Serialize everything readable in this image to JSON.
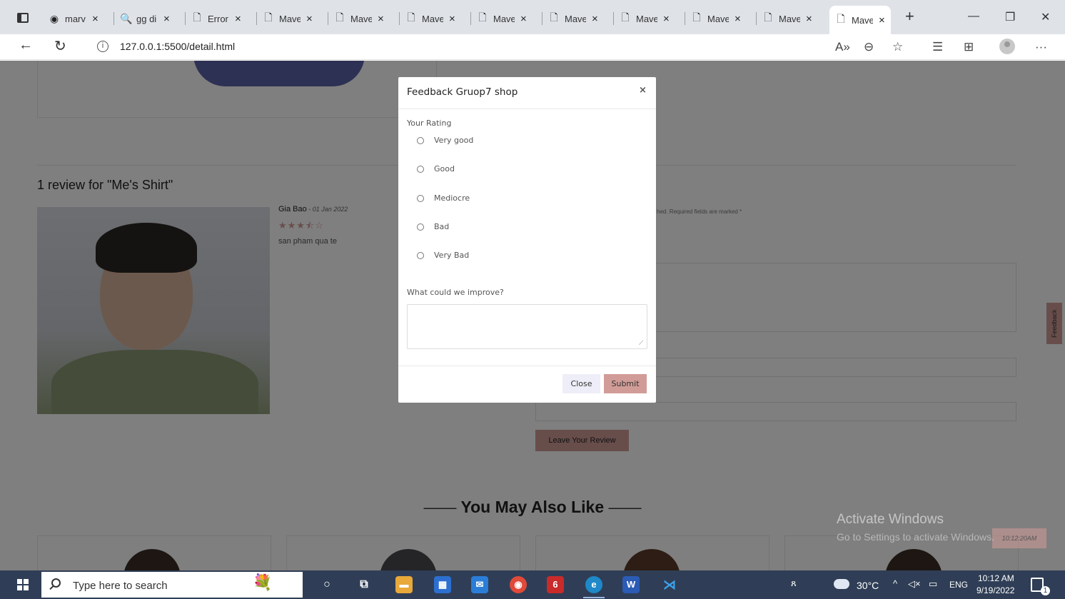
{
  "browser": {
    "tabs": [
      {
        "icon": "github-icon",
        "glyph": "◉",
        "label": "marv"
      },
      {
        "icon": "search-icon",
        "glyph": "🔍",
        "label": "gg di"
      },
      {
        "icon": "page-icon",
        "glyph": "🗋",
        "label": "Error"
      },
      {
        "icon": "page-icon",
        "glyph": "🗋",
        "label": "Mave"
      },
      {
        "icon": "page-icon",
        "glyph": "🗋",
        "label": "Mave"
      },
      {
        "icon": "page-icon",
        "glyph": "🗋",
        "label": "Mave"
      },
      {
        "icon": "page-icon",
        "glyph": "🗋",
        "label": "Mave"
      },
      {
        "icon": "page-icon",
        "glyph": "🗋",
        "label": "Mave"
      },
      {
        "icon": "page-icon",
        "glyph": "🗋",
        "label": "Mave"
      },
      {
        "icon": "page-icon",
        "glyph": "🗋",
        "label": "Mave"
      },
      {
        "icon": "page-icon",
        "glyph": "🗋",
        "label": "Mave"
      },
      {
        "icon": "page-icon",
        "glyph": "🗋",
        "label": "Mave",
        "active": true
      }
    ],
    "tab_close_glyph": "×",
    "new_tab_glyph": "+",
    "window_buttons": {
      "minimize": "—",
      "restore": "❐",
      "close": "✕"
    },
    "address": {
      "url": "127.0.0.1:5500/detail.html",
      "info_glyph": "i"
    },
    "toolbar_icons": {
      "read_aloud": "A»",
      "zoom": "⊖",
      "favorite": "☆",
      "favorites_list": "☰",
      "collections": "⊞",
      "more": "···"
    }
  },
  "page": {
    "reviews_title": "1 review for \"Me's Shirt\"",
    "review": {
      "name": "Gia Bao",
      "date": " - 01 Jan 2022",
      "stars": "★★★⯪☆",
      "rating": 3.5,
      "text": "san pham qua te"
    },
    "form_note": "hed. Required fields are marked *",
    "leave_review_label": "Leave Your Review",
    "also_like": {
      "title": "You May Also Like",
      "dash": "——"
    },
    "feedback_tab_label": "Feedback",
    "clock_chip": "10:12:20AM"
  },
  "windows_watermark": {
    "title": "Activate Windows",
    "subtitle": "Go to Settings to activate Windows."
  },
  "modal": {
    "title": "Feedback Gruop7 shop",
    "close_glyph": "×",
    "rating_label": "Your Rating",
    "options": [
      "Very good",
      "Good",
      "Mediocre",
      "Bad",
      "Very Bad"
    ],
    "improve_label": "What could we improve?",
    "textarea_value": "",
    "close_button": "Close",
    "submit_button": "Submit"
  },
  "taskbar": {
    "search_placeholder": "Type here to search",
    "weather": "30°C",
    "language": "ENG",
    "time": "10:12 AM",
    "date": "9/19/2022",
    "notification_count": "1"
  },
  "colors": {
    "accent": "#d19c97",
    "overlay": "rgba(0,0,0,0.5)",
    "taskbar": "#2f3e56",
    "tabbar": "#dfe3e8"
  }
}
